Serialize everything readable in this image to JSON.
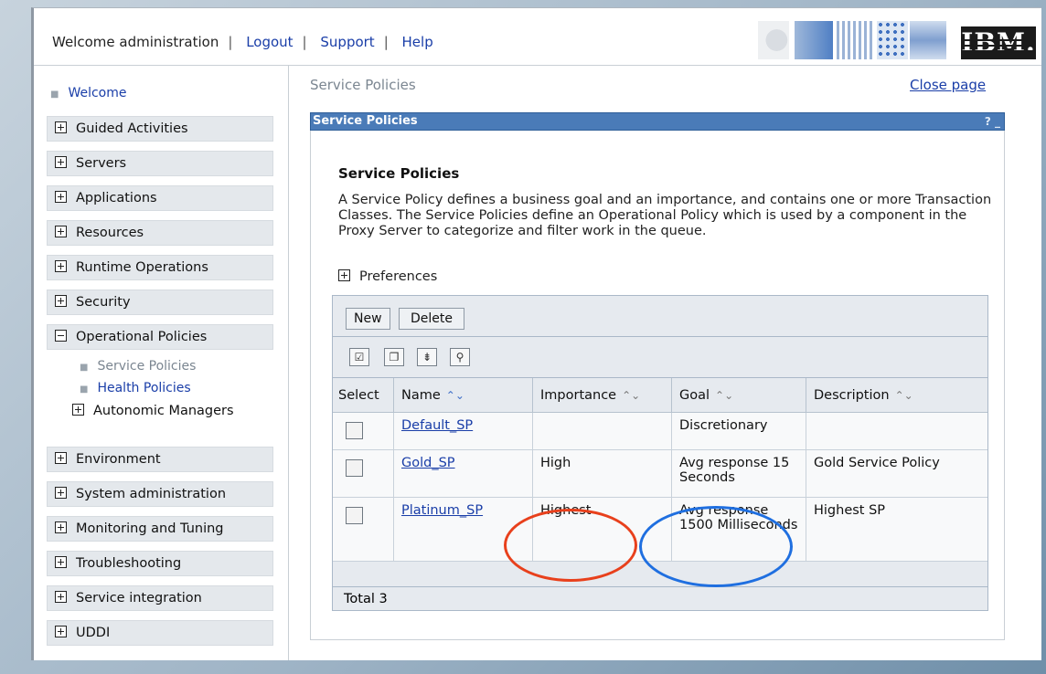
{
  "header": {
    "welcome": "Welcome administration",
    "links": [
      "Logout",
      "Support",
      "Help"
    ],
    "logo": "IBM."
  },
  "nav": {
    "welcome": "Welcome",
    "items": [
      "Guided Activities",
      "Servers",
      "Applications",
      "Resources",
      "Runtime Operations",
      "Security",
      "Operational Policies",
      "Environment",
      "System administration",
      "Monitoring and Tuning",
      "Troubleshooting",
      "Service integration",
      "UDDI"
    ],
    "operational_children": [
      "Service Policies",
      "Health Policies",
      "Autonomic Managers"
    ]
  },
  "main": {
    "breadcrumb": "Service Policies",
    "close": "Close page",
    "portlet_title": "Service Policies",
    "portlet_controls": "? _",
    "heading": "Service Policies",
    "description": "A Service Policy defines a business goal and an importance, and contains one or more Transaction Classes. The Service Policies define an Operational Policy which is used by a component in the Proxy Server to categorize and filter work in the queue.",
    "preferences": "Preferences",
    "buttons": [
      "New",
      "Delete"
    ],
    "columns": [
      "Select",
      "Name",
      "Importance",
      "Goal",
      "Description"
    ],
    "rows": [
      {
        "name": "Default_SP",
        "importance": "",
        "goal": "Discretionary",
        "description": ""
      },
      {
        "name": "Gold_SP",
        "importance": "High",
        "goal": "Avg response 15 Seconds",
        "description": "Gold Service Policy"
      },
      {
        "name": "Platinum_SP",
        "importance": "Highest",
        "goal": "Avg response 1500 Milliseconds",
        "description": "Highest SP"
      }
    ],
    "total": "Total 3"
  },
  "colors": {
    "portlet_bar": "#4a7bb8",
    "link": "#1a3ea8",
    "annotation_red": "#e8401c",
    "annotation_blue": "#1f6fe0"
  }
}
